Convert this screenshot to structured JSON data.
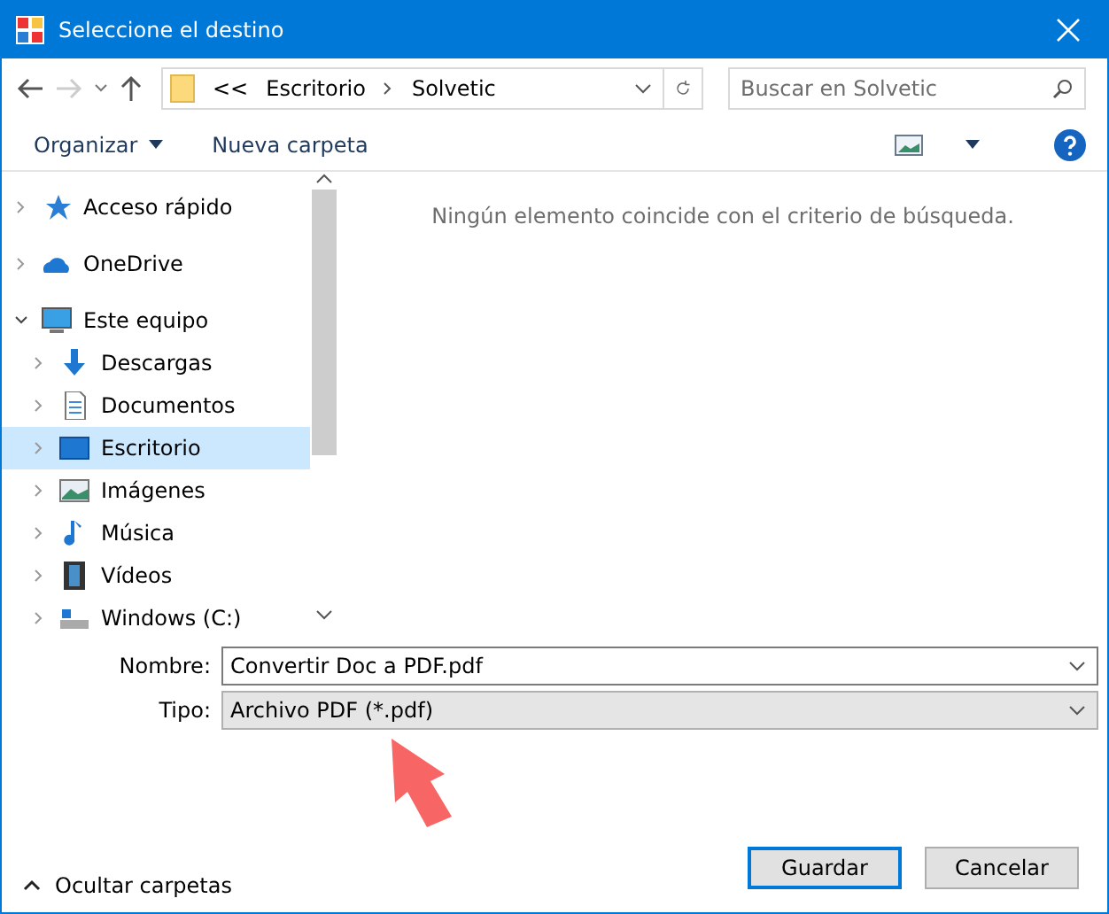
{
  "window": {
    "title": "Seleccione el destino"
  },
  "address": {
    "overflow": "<<",
    "path": [
      "Escritorio",
      "Solvetic"
    ]
  },
  "search": {
    "placeholder": "Buscar en Solvetic"
  },
  "toolbar": {
    "organize": "Organizar",
    "new_folder": "Nueva carpeta"
  },
  "tree": [
    {
      "label": "Acceso rápido",
      "kind": "star",
      "expanded": false,
      "selected": false
    },
    {
      "label": "OneDrive",
      "kind": "cloud",
      "expanded": false,
      "selected": false
    },
    {
      "label": "Este equipo",
      "kind": "computer",
      "expanded": true,
      "selected": false,
      "children": [
        {
          "label": "Descargas",
          "kind": "download",
          "expanded": false,
          "selected": false
        },
        {
          "label": "Documentos",
          "kind": "document",
          "expanded": false,
          "selected": false
        },
        {
          "label": "Escritorio",
          "kind": "desktop",
          "expanded": false,
          "selected": true
        },
        {
          "label": "Imágenes",
          "kind": "image",
          "expanded": false,
          "selected": false
        },
        {
          "label": "Música",
          "kind": "music",
          "expanded": false,
          "selected": false
        },
        {
          "label": "Vídeos",
          "kind": "video",
          "expanded": false,
          "selected": false
        },
        {
          "label": "Windows (C:)",
          "kind": "drive",
          "expanded": false,
          "selected": false
        }
      ]
    }
  ],
  "empty_message": "Ningún elemento coincide con el criterio de búsqueda.",
  "fields": [
    {
      "label": "Nombre:",
      "value": "Convertir Doc a PDF.pdf",
      "kind": "edit"
    },
    {
      "label": "Tipo:",
      "value": "Archivo PDF (*.pdf)",
      "kind": "select"
    }
  ],
  "hide_folders": "Ocultar carpetas",
  "buttons": [
    {
      "label": "Guardar",
      "default": true
    },
    {
      "label": "Cancelar",
      "default": false
    }
  ]
}
